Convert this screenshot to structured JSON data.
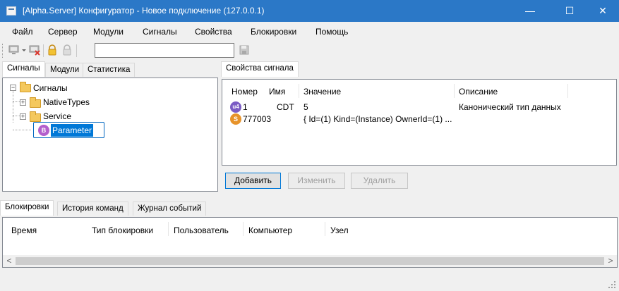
{
  "window": {
    "title": "[Alpha.Server] Конфигуратор - Новое подключение (127.0.0.1)",
    "minimize": "—",
    "maximize": "☐",
    "close": "✕"
  },
  "menu": {
    "items": [
      "Файл",
      "Сервер",
      "Модули",
      "Сигналы",
      "Свойства",
      "Блокировки",
      "Помощь"
    ]
  },
  "toolbar": {
    "search_value": "",
    "icons": [
      "connect-icon",
      "dropdown-arrow-icon",
      "disconnect-icon",
      "lock-icon",
      "unlock-icon",
      "save-icon"
    ]
  },
  "left_panel": {
    "tabs": [
      "Сигналы",
      "Модули",
      "Статистика"
    ],
    "tree": {
      "root": "Сигналы",
      "children": [
        "NativeTypes",
        "Service"
      ],
      "selected": "Parameter",
      "selected_badge": "B"
    }
  },
  "right_panel": {
    "tabs": [
      "Свойства сигнала"
    ],
    "columns": [
      "Номер",
      "Имя",
      "Значение",
      "Описание"
    ],
    "rows": [
      {
        "badge": "u4",
        "number": "1",
        "name": "CDT",
        "value": "5",
        "description": "Канонический тип данных"
      },
      {
        "badge": "S",
        "number": "777003",
        "name": "",
        "value": "{ Id=(1) Kind=(Instance) OwnerId=(1) ...",
        "description": ""
      }
    ],
    "buttons": {
      "add": "Добавить",
      "edit": "Изменить",
      "delete": "Удалить"
    }
  },
  "bottom_panel": {
    "tabs": [
      "Блокировки",
      "История команд",
      "Журнал событий"
    ],
    "columns": [
      "Время",
      "Тип блокировки",
      "Пользователь",
      "Компьютер",
      "Узел"
    ],
    "scroll_left": "<",
    "scroll_right": ">"
  },
  "colors": {
    "titlebar": "#2b78c7",
    "selection_border": "#0067c0",
    "badge_u4": "#7b5cc4",
    "badge_s": "#e7932a",
    "badge_b": "#b35fcc"
  }
}
